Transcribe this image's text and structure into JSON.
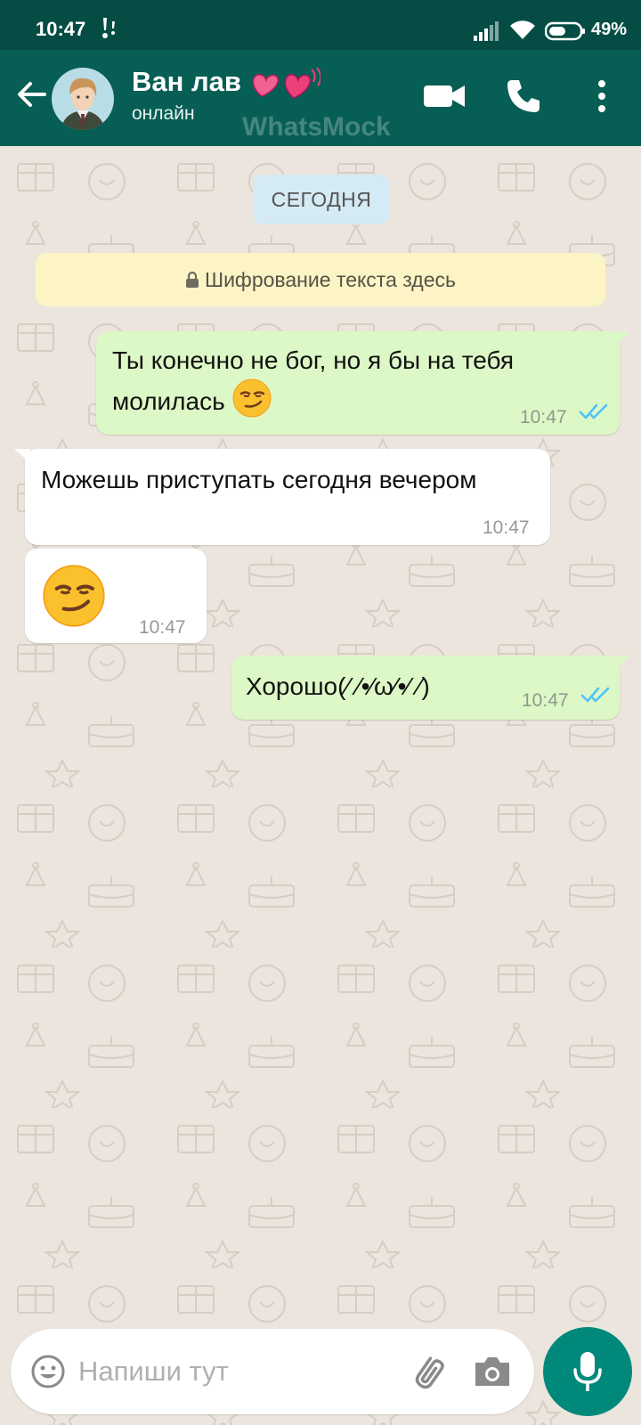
{
  "status_bar": {
    "time": "10:47",
    "battery": "49%"
  },
  "header": {
    "contact_name": "Ван лав",
    "contact_status": "онлайн",
    "watermark": "WhatsMock"
  },
  "chat": {
    "date_label": "СЕГОДНЯ",
    "encryption_notice": "Шифрование текста здесь",
    "messages": [
      {
        "direction": "out",
        "text": "Ты конечно не бог, но я бы на тебя молилась",
        "emoji": "smirking-face",
        "time": "10:47",
        "status": "read"
      },
      {
        "direction": "in",
        "text": "Можешь приступать сегодня вечером",
        "time": "10:47"
      },
      {
        "direction": "in",
        "emoji": "smirking-face",
        "time": "10:47"
      },
      {
        "direction": "out",
        "text": "Хорошо(⁄ ⁄•⁄ω⁄•⁄ ⁄)",
        "time": "10:47",
        "status": "read"
      }
    ]
  },
  "composer": {
    "placeholder": "Напиши тут"
  },
  "colors": {
    "header": "#075e54",
    "status_bar": "#054d44",
    "outgoing_bubble": "#dcf8c6",
    "read_ticks": "#4fc3f7",
    "mic_button": "#00897b"
  },
  "icons": [
    "back-arrow-icon",
    "video-camera-icon",
    "phone-icon",
    "more-vert-icon",
    "lock-icon",
    "double-check-icon",
    "emoji-icon",
    "paperclip-icon",
    "camera-icon",
    "microphone-icon"
  ]
}
